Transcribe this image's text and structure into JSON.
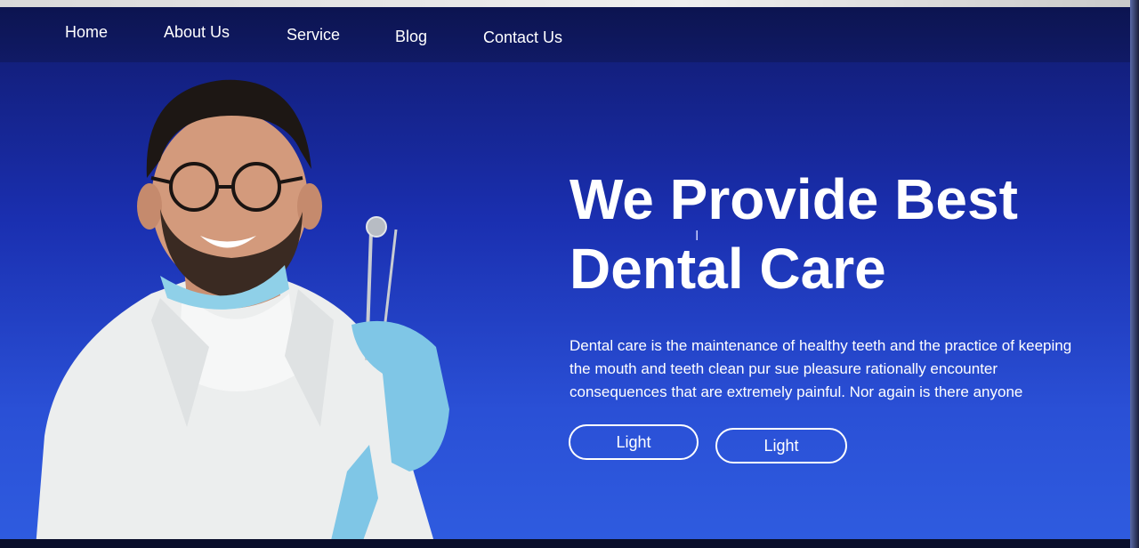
{
  "nav": {
    "items": [
      "Home",
      "About Us",
      "Service",
      "Blog",
      "Contact Us"
    ]
  },
  "hero": {
    "title_line1": "We Provide Best",
    "title_line2": "Dental Care",
    "description": "Dental care is the maintenance of healthy teeth and the practice of keeping the mouth and teeth clean pur sue pleasure rationally encounter consequences that are extremely painful. Nor again is there anyone",
    "button1_label": "Light",
    "button2_label": "Light"
  },
  "colors": {
    "bg_top": "#10196a",
    "bg_bottom": "#2f5ce0",
    "nav_bg": "#0c1450",
    "text": "#ffffff",
    "glove": "#7fc6e6",
    "coat": "#eef0f0"
  },
  "icons": {
    "cursor": "text-cursor-icon"
  }
}
